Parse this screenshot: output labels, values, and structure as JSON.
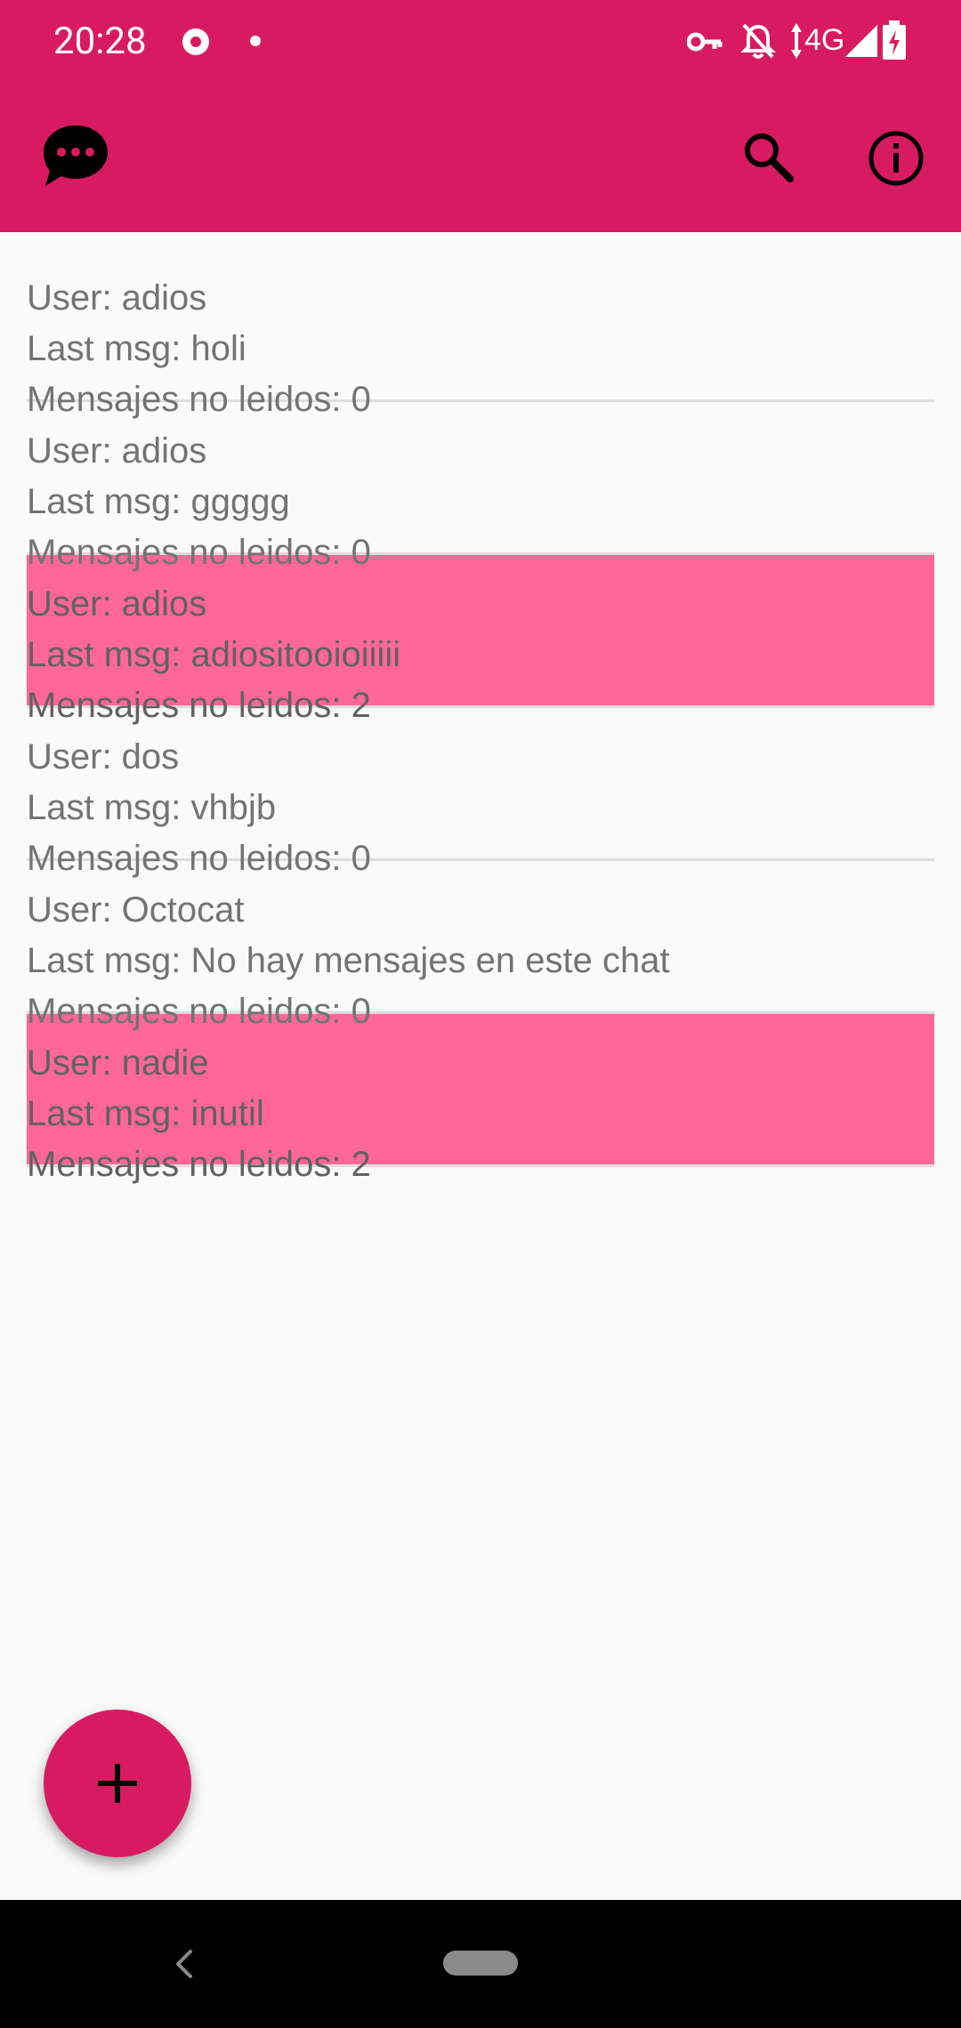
{
  "status_bar": {
    "time": "20:28",
    "network": "4G"
  },
  "app_bar": {
    "logo_icon": "chat-bubble-icon",
    "actions": [
      "search-icon",
      "info-icon"
    ]
  },
  "chats": [
    {
      "user": "User: adios",
      "last_msg": "Last msg: holi",
      "unread": "Mensajes no leidos: 0",
      "highlighted": false
    },
    {
      "user": "User: adios",
      "last_msg": "Last msg: ggggg",
      "unread": "Mensajes no leidos: 0",
      "highlighted": false
    },
    {
      "user": "User: adios",
      "last_msg": "Last msg: adiositooioiiiii",
      "unread": "Mensajes no leidos: 2",
      "highlighted": true
    },
    {
      "user": "User: dos",
      "last_msg": "Last msg: vhbjb",
      "unread": "Mensajes no leidos: 0",
      "highlighted": false
    },
    {
      "user": "User: Octocat",
      "last_msg": "Last msg: No hay mensajes en este chat",
      "unread": "Mensajes no leidos: 0",
      "highlighted": false
    },
    {
      "user": "User: nadie",
      "last_msg": "Last msg: inutil",
      "unread": "Mensajes no leidos: 2",
      "highlighted": true
    }
  ],
  "fab": {
    "icon": "plus-icon"
  },
  "colors": {
    "primary": "#d81b60",
    "unread_highlight": "#ff6699",
    "background": "#fafafa"
  }
}
